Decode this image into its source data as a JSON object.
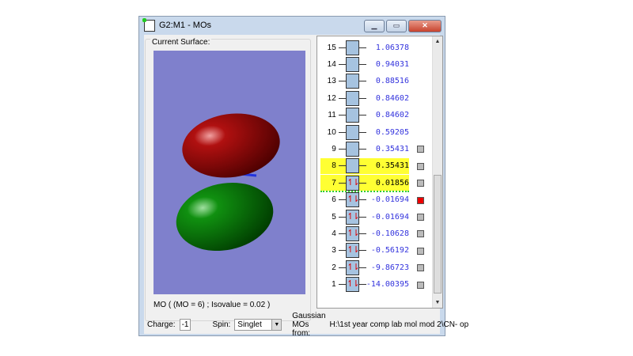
{
  "window": {
    "title": "G2:M1 - MOs",
    "minimize": "▁",
    "maximize": "▭",
    "close": "✕"
  },
  "surface": {
    "group_label": "Current Surface:",
    "caption": "MO ( (MO = 6) ; Isovalue = 0.02 )"
  },
  "orbitals": [
    {
      "n": "15",
      "energy": "1.06378",
      "occ": "",
      "hl": false,
      "marker": null
    },
    {
      "n": "14",
      "energy": "0.94031",
      "occ": "",
      "hl": false,
      "marker": null
    },
    {
      "n": "13",
      "energy": "0.88516",
      "occ": "",
      "hl": false,
      "marker": null
    },
    {
      "n": "12",
      "energy": "0.84602",
      "occ": "",
      "hl": false,
      "marker": null
    },
    {
      "n": "11",
      "energy": "0.84602",
      "occ": "",
      "hl": false,
      "marker": null
    },
    {
      "n": "10",
      "energy": "0.59205",
      "occ": "",
      "hl": false,
      "marker": null
    },
    {
      "n": "9",
      "energy": "0.35431",
      "occ": "",
      "hl": false,
      "marker": "gray"
    },
    {
      "n": "8",
      "energy": "0.35431",
      "occ": "",
      "hl": true,
      "marker": "gray"
    },
    {
      "n": "7",
      "energy": "0.01856",
      "occ": "↿⇂",
      "hl": true,
      "marker": "gray"
    },
    {
      "n": "6",
      "energy": "-0.01694",
      "occ": "↿⇂",
      "hl": false,
      "marker": "red"
    },
    {
      "n": "5",
      "energy": "-0.01694",
      "occ": "↿⇂",
      "hl": false,
      "marker": "gray"
    },
    {
      "n": "4",
      "energy": "-0.10628",
      "occ": "↿⇂",
      "hl": false,
      "marker": "gray"
    },
    {
      "n": "3",
      "energy": "-0.56192",
      "occ": "↿⇂",
      "hl": false,
      "marker": "gray"
    },
    {
      "n": "2",
      "energy": "-9.86723",
      "occ": "↿⇂",
      "hl": false,
      "marker": "gray"
    },
    {
      "n": "1",
      "energy": "-14.00395",
      "occ": "↿⇂",
      "hl": false,
      "marker": "gray"
    }
  ],
  "bottom": {
    "charge_label": "Charge:",
    "charge": "-1",
    "spin_label": "Spin:",
    "spin": "Singlet",
    "source_label": "Gaussian MOs from:",
    "source": "H:\\1st year comp lab mol mod 2\\CN- op"
  }
}
